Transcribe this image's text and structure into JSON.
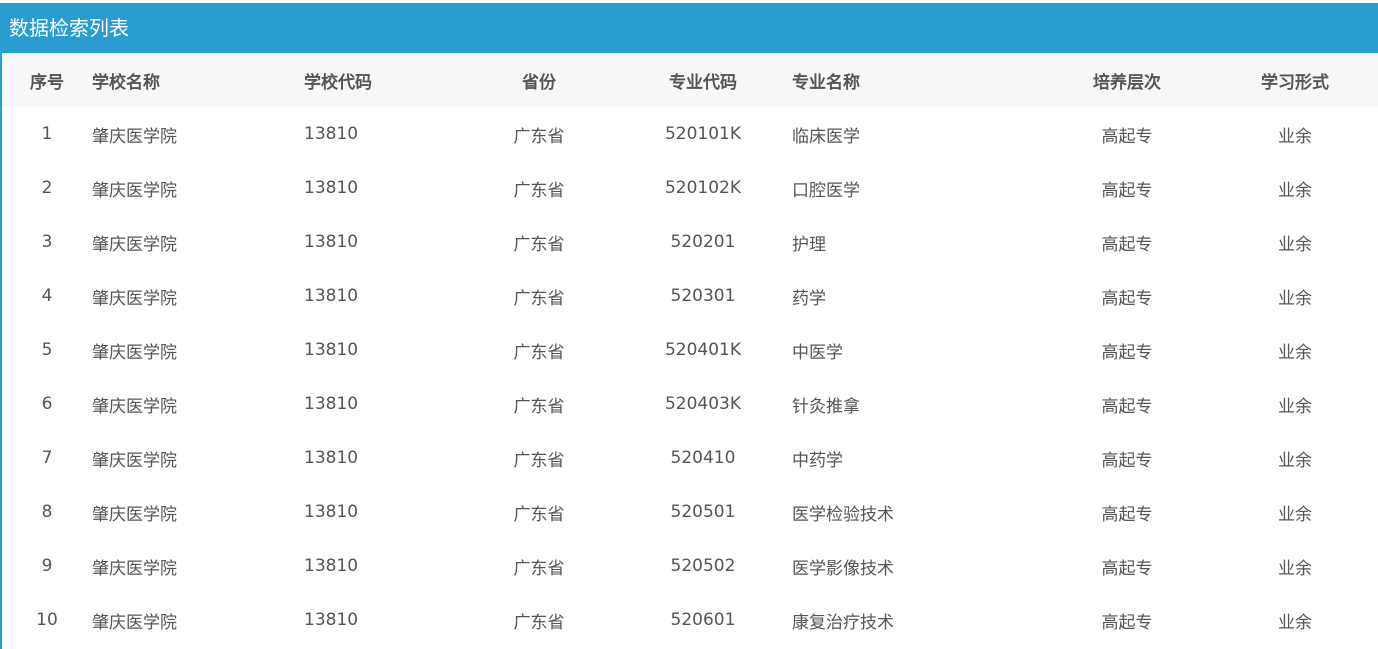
{
  "panel": {
    "title": "数据检索列表"
  },
  "table": {
    "headers": {
      "index": "序号",
      "school_name": "学校名称",
      "school_code": "学校代码",
      "province": "省份",
      "major_code": "专业代码",
      "major_name": "专业名称",
      "level": "培养层次",
      "study_form": "学习形式"
    },
    "rows": [
      {
        "index": "1",
        "school_name": "肇庆医学院",
        "school_code": "13810",
        "province": "广东省",
        "major_code": "520101K",
        "major_name": "临床医学",
        "level": "高起专",
        "study_form": "业余"
      },
      {
        "index": "2",
        "school_name": "肇庆医学院",
        "school_code": "13810",
        "province": "广东省",
        "major_code": "520102K",
        "major_name": "口腔医学",
        "level": "高起专",
        "study_form": "业余"
      },
      {
        "index": "3",
        "school_name": "肇庆医学院",
        "school_code": "13810",
        "province": "广东省",
        "major_code": "520201",
        "major_name": "护理",
        "level": "高起专",
        "study_form": "业余"
      },
      {
        "index": "4",
        "school_name": "肇庆医学院",
        "school_code": "13810",
        "province": "广东省",
        "major_code": "520301",
        "major_name": "药学",
        "level": "高起专",
        "study_form": "业余"
      },
      {
        "index": "5",
        "school_name": "肇庆医学院",
        "school_code": "13810",
        "province": "广东省",
        "major_code": "520401K",
        "major_name": "中医学",
        "level": "高起专",
        "study_form": "业余"
      },
      {
        "index": "6",
        "school_name": "肇庆医学院",
        "school_code": "13810",
        "province": "广东省",
        "major_code": "520403K",
        "major_name": "针灸推拿",
        "level": "高起专",
        "study_form": "业余"
      },
      {
        "index": "7",
        "school_name": "肇庆医学院",
        "school_code": "13810",
        "province": "广东省",
        "major_code": "520410",
        "major_name": "中药学",
        "level": "高起专",
        "study_form": "业余"
      },
      {
        "index": "8",
        "school_name": "肇庆医学院",
        "school_code": "13810",
        "province": "广东省",
        "major_code": "520501",
        "major_name": "医学检验技术",
        "level": "高起专",
        "study_form": "业余"
      },
      {
        "index": "9",
        "school_name": "肇庆医学院",
        "school_code": "13810",
        "province": "广东省",
        "major_code": "520502",
        "major_name": "医学影像技术",
        "level": "高起专",
        "study_form": "业余"
      },
      {
        "index": "10",
        "school_name": "肇庆医学院",
        "school_code": "13810",
        "province": "广东省",
        "major_code": "520601",
        "major_name": "康复治疗技术",
        "level": "高起专",
        "study_form": "业余"
      }
    ]
  }
}
